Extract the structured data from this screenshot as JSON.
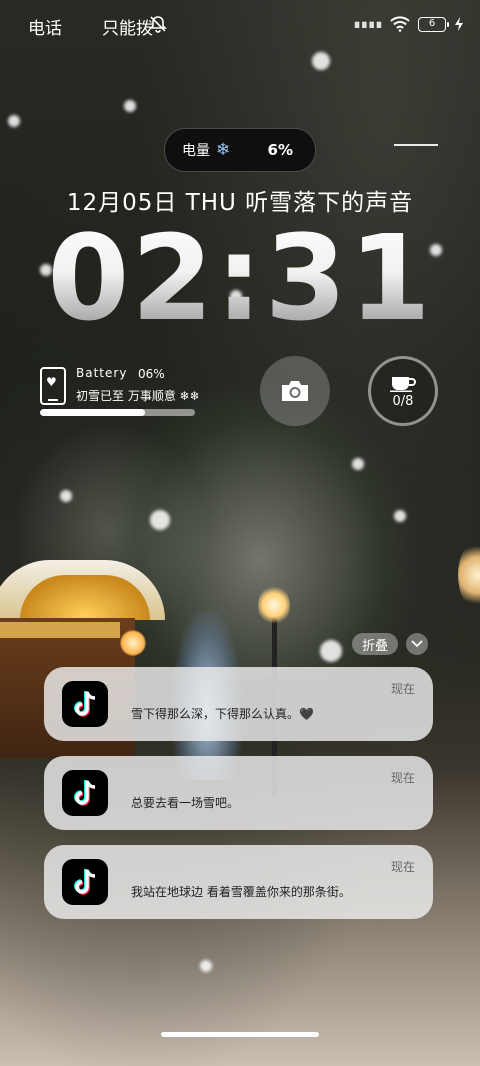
{
  "status_bar": {
    "left_label_1": "电话",
    "left_label_2": "只能拨",
    "signal_text": "∎∎∎∎",
    "battery_level": "6",
    "icons": [
      "bell-off-icon",
      "wifi-icon",
      "battery-icon",
      "charging-bolt-icon"
    ]
  },
  "top_pill": {
    "label": "电量",
    "flake": "❄",
    "value": "6%"
  },
  "date_line": "12月05日  THU  听雪落下的声音",
  "clock": "02:31",
  "battery_widget": {
    "title": "Battery",
    "percent": "06%",
    "text": "初雪已至 万事顺意 ❄❄",
    "fill_fraction": 0.68
  },
  "camera_button": {
    "icon": "camera-icon"
  },
  "water_widget": {
    "icon": "cup-icon",
    "count": "0/8"
  },
  "notifications": {
    "fold_label": "折叠",
    "items": [
      {
        "app_icon": "tiktok-icon",
        "message": "雪下得那么深，下得那么认真。🖤",
        "time": "现在"
      },
      {
        "app_icon": "tiktok-icon",
        "message": "总要去看一场雪吧。",
        "time": "现在"
      },
      {
        "app_icon": "tiktok-icon",
        "message": "我站在地球边 看着雪覆盖你来的那条街。",
        "time": "现在"
      }
    ]
  },
  "colors": {
    "accent_flake": "#8fc8ff",
    "card_bg": "#eeeeee"
  }
}
